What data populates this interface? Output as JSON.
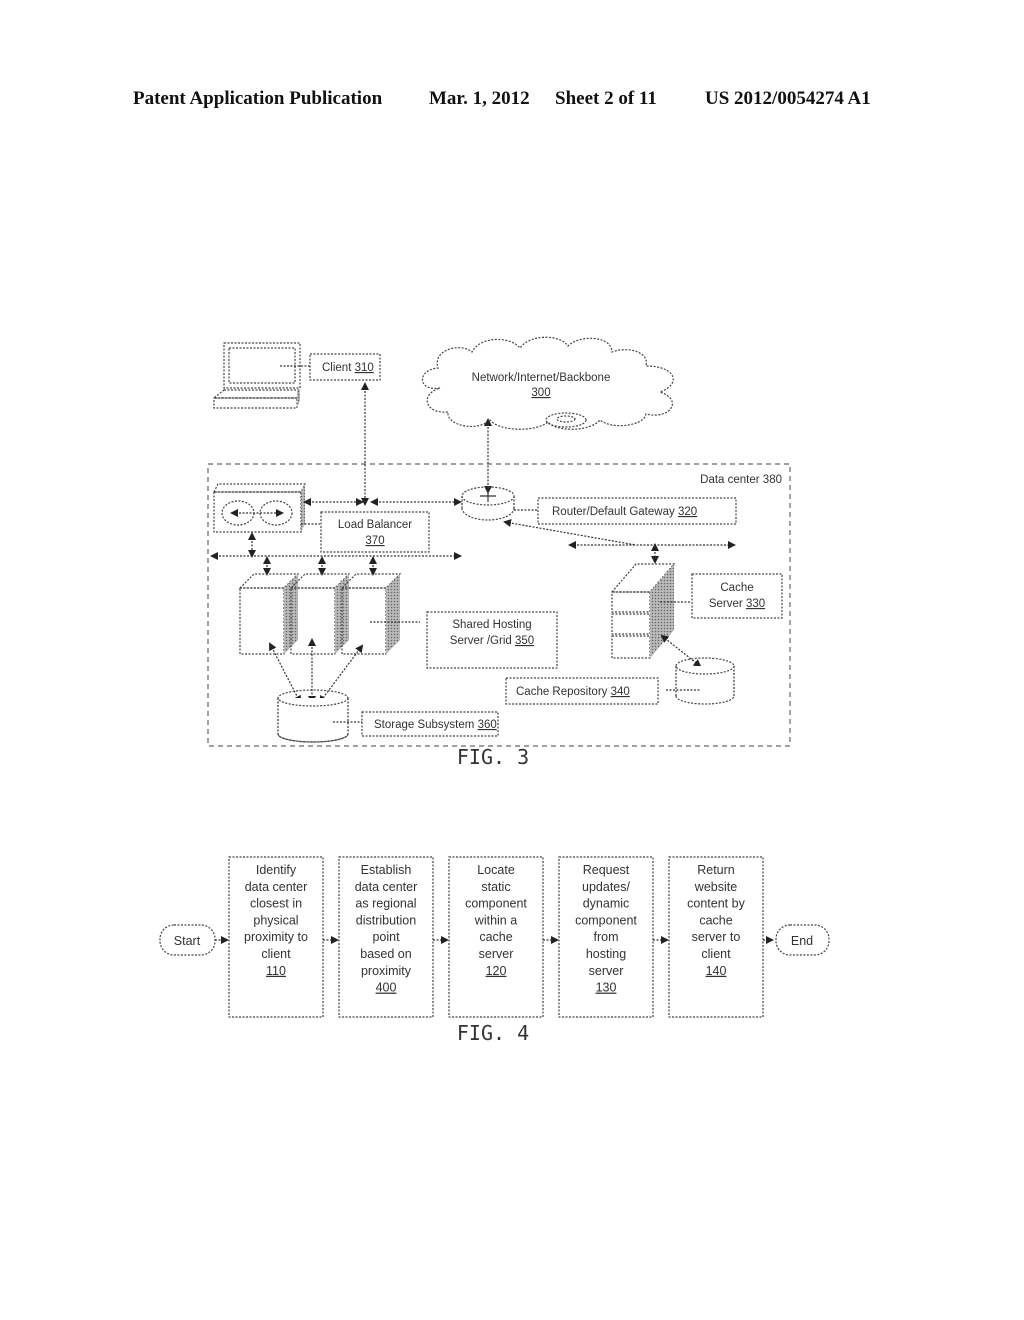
{
  "header": {
    "publication": "Patent Application Publication",
    "date": "Mar. 1, 2012",
    "sheet": "Sheet 2 of 11",
    "number": "US 2012/0054274 A1"
  },
  "fig3": {
    "caption": "FIG. 3",
    "client": {
      "label": "Client",
      "ref": "310"
    },
    "network": {
      "label": "Network/Internet/Backbone",
      "ref": "300"
    },
    "data_center": {
      "label": "Data center 380"
    },
    "load_balancer": {
      "label": "Load Balancer",
      "ref": "370"
    },
    "router": {
      "label": "Router/Default Gateway",
      "ref": "320"
    },
    "cache_server": {
      "line1": "Cache",
      "line2": "Server",
      "ref": "330"
    },
    "shared_hosting": {
      "line1": "Shared Hosting",
      "line2": "Server /Grid",
      "ref": "350"
    },
    "cache_repository": {
      "label": "Cache Repository",
      "ref": "340"
    },
    "storage": {
      "label": "Storage Subsystem",
      "ref": "360"
    }
  },
  "fig4": {
    "caption": "FIG. 4",
    "start": "Start",
    "end": "End",
    "steps": [
      {
        "lines": [
          "Identify",
          "data center",
          "closest in",
          "physical",
          "proximity to",
          "client"
        ],
        "ref": "110"
      },
      {
        "lines": [
          "Establish",
          "data center",
          "as regional",
          "distribution",
          "point",
          "based on",
          "proximity"
        ],
        "ref": "400"
      },
      {
        "lines": [
          "Locate",
          "static",
          "component",
          "within a",
          "cache",
          "server"
        ],
        "ref": "120"
      },
      {
        "lines": [
          "Request",
          "updates/",
          "dynamic",
          "component",
          "from",
          "hosting",
          "server"
        ],
        "ref": "130"
      },
      {
        "lines": [
          "Return",
          "website",
          "content by",
          "cache",
          "server to",
          "client"
        ],
        "ref": "140"
      }
    ]
  }
}
